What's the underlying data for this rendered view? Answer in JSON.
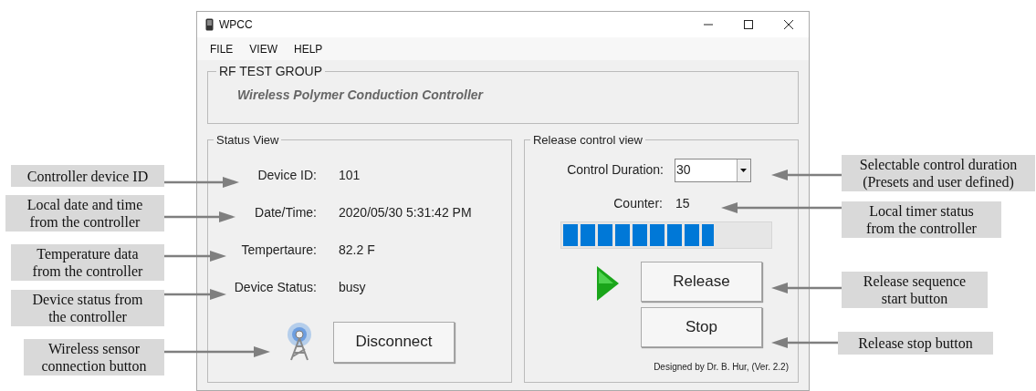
{
  "window": {
    "title": "WPCC"
  },
  "menu": [
    "FILE",
    "VIEW",
    "HELP"
  ],
  "header_group": {
    "title": "RF TEST GROUP",
    "subtitle": "Wireless Polymer Conduction Controller"
  },
  "status_view": {
    "title": "Status View",
    "fields": [
      {
        "label": "Device ID:",
        "value": "101"
      },
      {
        "label": "Date/Time:",
        "value": "2020/05/30 5:31:42 PM"
      },
      {
        "label": "Tempertaure:",
        "value": "82.2 F"
      },
      {
        "label": "Device Status:",
        "value": "busy"
      }
    ],
    "connect_button": "Disconnect"
  },
  "release_view": {
    "title": "Release control view",
    "duration_label": "Control Duration:",
    "duration_value": "30",
    "counter_label": "Counter:",
    "counter_value": "15",
    "progress": {
      "level": 0.73
    },
    "release_button": "Release",
    "stop_button": "Stop",
    "credit": "Designed by Dr. B. Hur, (Ver. 2.2)"
  },
  "annotations_left": [
    {
      "text": "Controller device ID"
    },
    {
      "text": "Local date and time from the controller"
    },
    {
      "text": "Temperature data from the controller"
    },
    {
      "text": "Device status from the controller"
    },
    {
      "text": "Wireless sensor connection button"
    }
  ],
  "annotations_right": [
    {
      "text": "Selectable control duration (Presets and user defined)"
    },
    {
      "text": "Local timer status from the controller"
    },
    {
      "text": "Release sequence start button"
    },
    {
      "text": "Release stop button"
    }
  ]
}
